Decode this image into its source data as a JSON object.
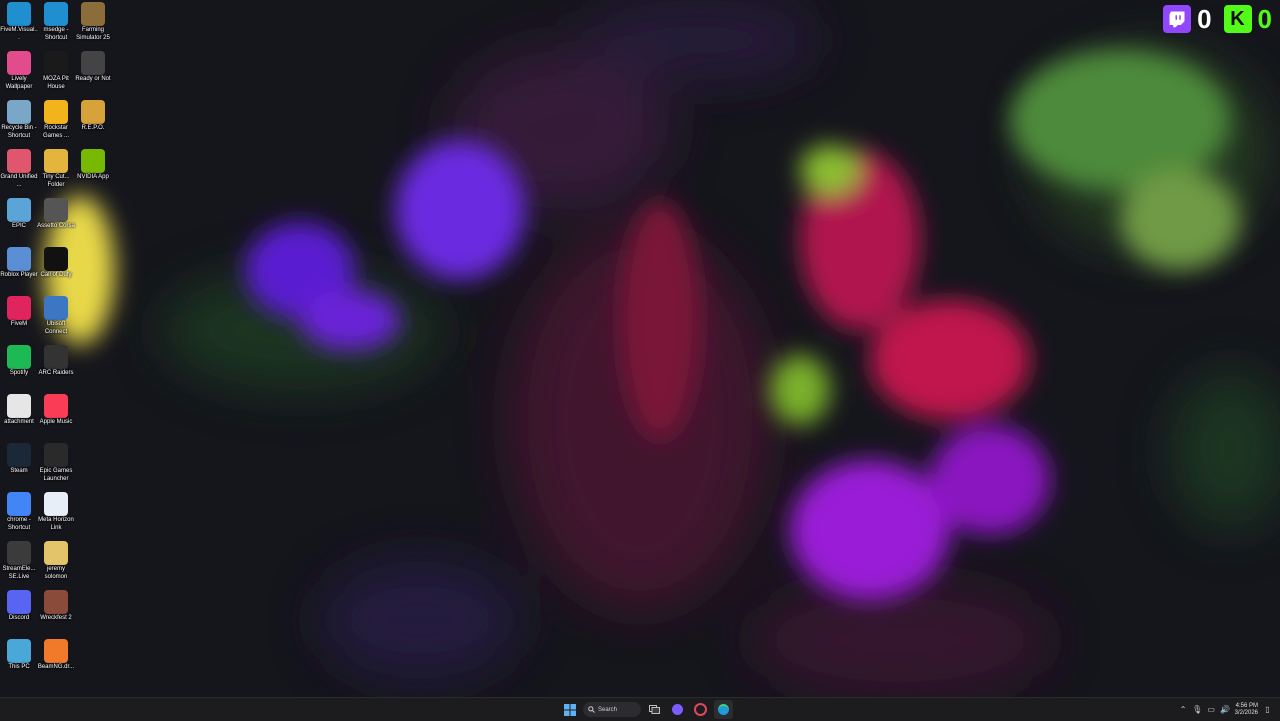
{
  "desktop": {
    "icons": [
      {
        "label": "FiveM.Visual...",
        "icon": "edge-icon",
        "color": "#1f8fd0"
      },
      {
        "label": "msedge - Shortcut",
        "icon": "edge-icon",
        "color": "#1f8fd0"
      },
      {
        "label": "Farming Simulator 25",
        "icon": "game-icon",
        "color": "#8a6d3b"
      },
      {
        "label": "Lively Wallpaper",
        "icon": "lively-icon",
        "color": "#e24b8c"
      },
      {
        "label": "MOZA Pit House",
        "icon": "moza-icon",
        "color": "#1a1a1a"
      },
      {
        "label": "Ready or Not",
        "icon": "game-icon",
        "color": "#444444"
      },
      {
        "label": "Recycle Bin - Shortcut",
        "icon": "recycle-bin-icon",
        "color": "#7aa7c7"
      },
      {
        "label": "Rockstar Games ...",
        "icon": "rockstar-icon",
        "color": "#f3b31a"
      },
      {
        "label": "R.E.P.O.",
        "icon": "game-icon",
        "color": "#d8a23b"
      },
      {
        "label": "Grand Unified ...",
        "icon": "app-icon",
        "color": "#e0566d"
      },
      {
        "label": "Tiny Cut... Folder",
        "icon": "folder-icon",
        "color": "#e3b53c"
      },
      {
        "label": "NVIDIA App",
        "icon": "nvidia-icon",
        "color": "#76b900"
      },
      {
        "label": "EPIC",
        "icon": "app-icon",
        "color": "#5ba4d8"
      },
      {
        "label": "Assetto Corsa",
        "icon": "game-icon",
        "color": "#555555"
      },
      {
        "label": "Roblox Player",
        "icon": "roblox-icon",
        "color": "#5a8fd6"
      },
      {
        "label": "Call of Duty",
        "icon": "game-icon",
        "color": "#111111"
      },
      {
        "label": "FiveM",
        "icon": "fivem-icon",
        "color": "#e0245e"
      },
      {
        "label": "Ubisoft Connect",
        "icon": "ubisoft-icon",
        "color": "#3d77c4"
      },
      {
        "label": "Spotify",
        "icon": "spotify-icon",
        "color": "#1db954"
      },
      {
        "label": "ARC Raiders",
        "icon": "game-icon",
        "color": "#333333"
      },
      {
        "label": "attachment",
        "icon": "file-icon",
        "color": "#e6e6e6"
      },
      {
        "label": "Apple Music",
        "icon": "apple-music-icon",
        "color": "#fa3c56"
      },
      {
        "label": "Steam",
        "icon": "steam-icon",
        "color": "#1b2838"
      },
      {
        "label": "Epic Games Launcher",
        "icon": "epic-icon",
        "color": "#2a2a2a"
      },
      {
        "label": "chrome - Shortcut",
        "icon": "chrome-icon",
        "color": "#4285f4"
      },
      {
        "label": "Meta Horizon Link",
        "icon": "meta-icon",
        "color": "#e8eef7"
      },
      {
        "label": "StreamEle... SE.Live",
        "icon": "streamelements-icon",
        "color": "#3b3b3b"
      },
      {
        "label": "jeremy solomon",
        "icon": "folder-icon",
        "color": "#e3c46a"
      },
      {
        "label": "Discord",
        "icon": "discord-icon",
        "color": "#5865f2"
      },
      {
        "label": "Wreckfest 2",
        "icon": "game-icon",
        "color": "#8a4b3a"
      },
      {
        "label": "This PC",
        "icon": "computer-icon",
        "color": "#4aa8d8"
      },
      {
        "label": "BeamNG.dr...",
        "icon": "beamng-icon",
        "color": "#f07a2a"
      }
    ]
  },
  "overlay": {
    "twitch_count": "0",
    "kick_count": "0",
    "twitch_color": "#9146ff",
    "kick_color": "#53fc18"
  },
  "taskbar": {
    "search_label": "Search",
    "time": "4:56 PM",
    "date": "3/2/2026"
  }
}
